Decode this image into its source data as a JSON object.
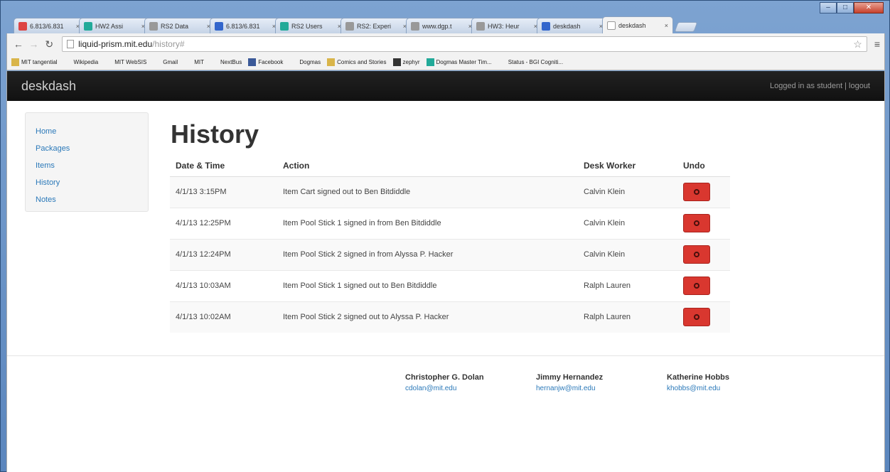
{
  "browser": {
    "tabs": [
      {
        "title": "6.813/6.831",
        "color": "#d44"
      },
      {
        "title": "HW2 Assi",
        "color": "#2a9"
      },
      {
        "title": "RS2 Data",
        "color": "#999"
      },
      {
        "title": "6.813/6.831",
        "color": "#36c"
      },
      {
        "title": "RS2 Users",
        "color": "#2a9"
      },
      {
        "title": "RS2: Experi",
        "color": "#999"
      },
      {
        "title": "www.dgp.t",
        "color": "#999"
      },
      {
        "title": "HW3: Heur",
        "color": "#999"
      },
      {
        "title": "deskdash",
        "color": "#36c"
      },
      {
        "title": "deskdash",
        "color": "#fff",
        "active": true
      }
    ],
    "address": {
      "host": "liquid-prism.mit.edu",
      "path": "/history#"
    },
    "bookmarks": [
      {
        "label": "MIT tangential",
        "icon": "folder-icon",
        "color": "#d9b54a"
      },
      {
        "label": "Wikipedia",
        "icon": "wikipedia-icon",
        "color": "#555"
      },
      {
        "label": "MIT WebSIS",
        "icon": "mit-icon",
        "color": "#a31f34"
      },
      {
        "label": "Gmail",
        "icon": "gmail-icon",
        "color": "#d44"
      },
      {
        "label": "MIT",
        "icon": "mit-icon",
        "color": "#a31f34"
      },
      {
        "label": "NextBus",
        "icon": "bus-icon",
        "color": "#333"
      },
      {
        "label": "Facebook",
        "icon": "facebook-icon",
        "color": "#3b5998"
      },
      {
        "label": "Dogmas",
        "icon": "dogmas-icon",
        "color": "#c00"
      },
      {
        "label": "Comics and Stories",
        "icon": "folder-icon",
        "color": "#d9b54a"
      },
      {
        "label": "zephyr",
        "icon": "zephyr-icon",
        "color": "#333"
      },
      {
        "label": "Dogmas Master Tim...",
        "icon": "sheet-icon",
        "color": "#2a9"
      },
      {
        "label": "Status - BGI Cogniti...",
        "icon": "status-icon",
        "color": "#888"
      }
    ]
  },
  "app": {
    "brand": "deskdash",
    "login_text": "Logged in as student",
    "separator": "|",
    "logout": "logout"
  },
  "sidebar": {
    "items": [
      {
        "label": "Home"
      },
      {
        "label": "Packages"
      },
      {
        "label": "Items"
      },
      {
        "label": "History"
      },
      {
        "label": "Notes"
      }
    ]
  },
  "main": {
    "title": "History",
    "columns": {
      "date": "Date & Time",
      "action": "Action",
      "worker": "Desk Worker",
      "undo": "Undo"
    },
    "rows": [
      {
        "date": "4/1/13 3:15PM",
        "action": "Item Cart signed out to Ben Bitdiddle",
        "worker": "Calvin Klein"
      },
      {
        "date": "4/1/13 12:25PM",
        "action": "Item Pool Stick 1 signed in from Ben Bitdiddle",
        "worker": "Calvin Klein"
      },
      {
        "date": "4/1/13 12:24PM",
        "action": "Item Pool Stick 2 signed in from Alyssa P. Hacker",
        "worker": "Calvin Klein"
      },
      {
        "date": "4/1/13 10:03AM",
        "action": "Item Pool Stick 1 signed out to Ben Bitdiddle",
        "worker": "Ralph Lauren"
      },
      {
        "date": "4/1/13 10:02AM",
        "action": "Item Pool Stick 2 signed out to Alyssa P. Hacker",
        "worker": "Ralph Lauren"
      }
    ],
    "undo_color": "#d9372f"
  },
  "footer": {
    "authors": [
      {
        "name": "Christopher G. Dolan",
        "email": "cdolan@mit.edu"
      },
      {
        "name": "Jimmy Hernandez",
        "email": "hernanjw@mit.edu"
      },
      {
        "name": "Katherine Hobbs",
        "email": "khobbs@mit.edu"
      }
    ]
  }
}
